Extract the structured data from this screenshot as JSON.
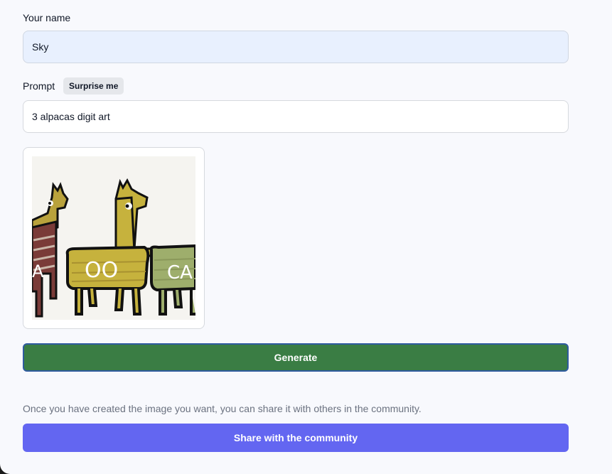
{
  "form": {
    "name_label": "Your name",
    "name_value": "Sky",
    "prompt_label": "Prompt",
    "surprise_label": "Surprise me",
    "prompt_value": "3 alpacas digit art"
  },
  "image": {
    "alt": "3 alpacas digit art",
    "left_text": "A",
    "middle_text": "OO",
    "right_text": "CA"
  },
  "actions": {
    "generate_label": "Generate",
    "share_hint": "Once you have created the image you want, you can share it with others in the community.",
    "share_label": "Share with the community"
  },
  "colors": {
    "generate": "#3a7d44",
    "share": "#6366f1"
  }
}
